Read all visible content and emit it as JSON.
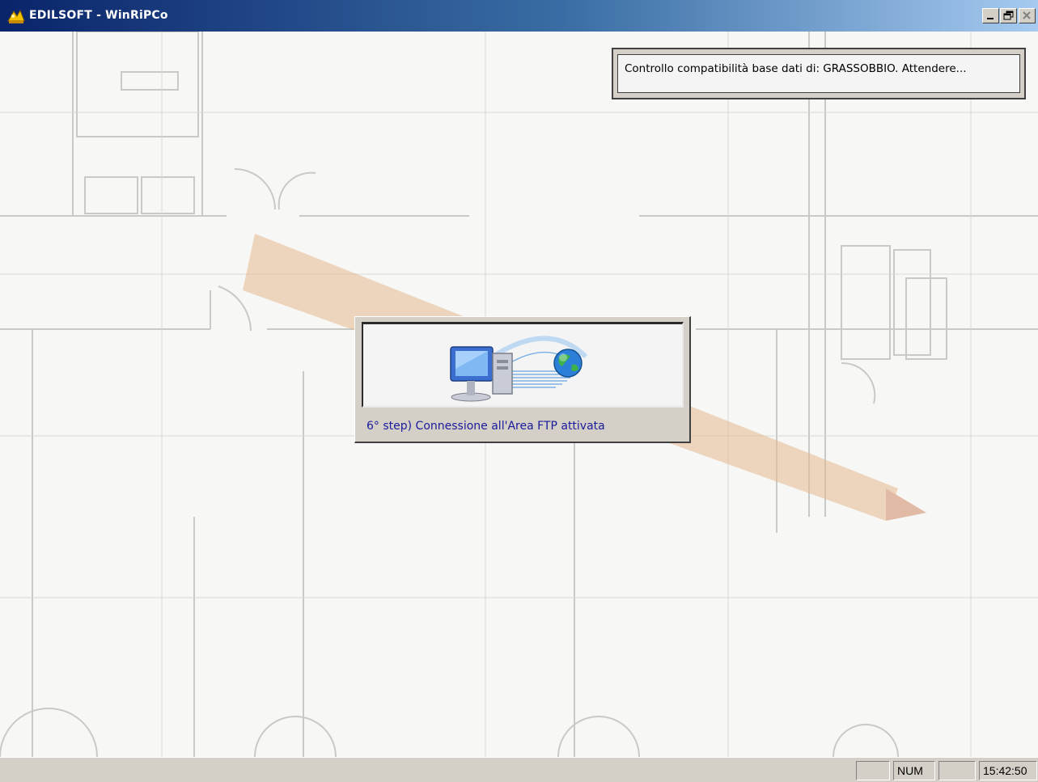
{
  "window": {
    "title": "EDILSOFT - WinRiPCo",
    "app_icon": "edilsoft-logo-icon",
    "controls": [
      "minimize-icon",
      "maximize-icon",
      "close-icon"
    ]
  },
  "toast": {
    "message": "Controllo compatibilità base dati di: GRASSOBBIO. Attendere..."
  },
  "progress_dialog": {
    "illustration": "computer-to-globe-ftp-icon",
    "status_text": "6° step) Connessione all'Area FTP attivata"
  },
  "statusbar": {
    "main_text": "",
    "pane1": "",
    "num_indicator": "NUM",
    "pane3": "",
    "clock": "15:42:50"
  },
  "colors": {
    "titlebar_start": "#0a246a",
    "titlebar_end": "#a6caf0",
    "dialog_face": "#d4d0c8",
    "status_text": "#1a1a9c"
  }
}
